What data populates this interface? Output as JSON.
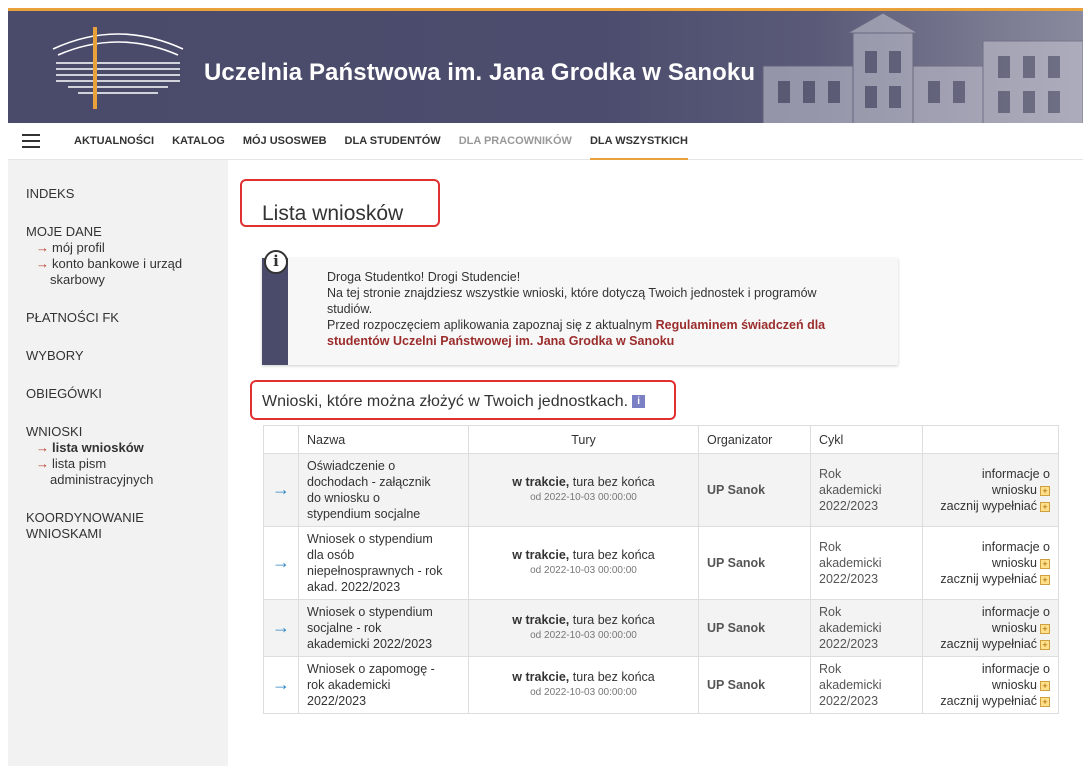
{
  "header": {
    "title": "Uczelnia Państwowa im. Jana Grodka w Sanoku"
  },
  "nav": {
    "items": [
      {
        "label": "AKTUALNOŚCI"
      },
      {
        "label": "KATALOG"
      },
      {
        "label": "MÓJ USOSWEB"
      },
      {
        "label": "DLA STUDENTÓW"
      },
      {
        "label": "DLA PRACOWNIKÓW"
      },
      {
        "label": "DLA WSZYSTKICH"
      }
    ]
  },
  "sidebar": {
    "indeks": "INDEKS",
    "moje_dane": "MOJE DANE",
    "moj_profil": "mój profil",
    "konto_1": "konto bankowe i urząd",
    "konto_2": "skarbowy",
    "platnosci": "PŁATNOŚCI FK",
    "wybory": "WYBORY",
    "obiegowki": "OBIEGÓWKI",
    "wnioski": "WNIOSKI",
    "lista_wnioskow": "lista wniosków",
    "lista_pism_1": "lista pism",
    "lista_pism_2": "administracyjnych",
    "koord_1": "KOORDYNOWANIE",
    "koord_2": "WNIOSKAMI"
  },
  "main": {
    "title": "Lista wniosków",
    "info": {
      "line1": "Droga Studentko! Drogi Studencie!",
      "line2": "Na tej stronie znajdziesz wszystkie wnioski, które dotyczą Twoich jednostek i programów",
      "line3": "studiów.",
      "line4": "Przed rozpoczęciem aplikowania zapoznaj się z aktualnym ",
      "link1": "Regulaminem świadczeń dla",
      "link2": "studentów Uczelni Państwowej im. Jana Grodka w Sanoku"
    },
    "subtitle": "Wnioski, które można złożyć w Twoich jednostkach.",
    "table": {
      "headers": {
        "nazwa": "Nazwa",
        "tury": "Tury",
        "organizator": "Organizator",
        "cykl": "Cykl"
      },
      "rows": [
        {
          "name_lines": [
            "Oświadczenie o",
            "dochodach - załącznik",
            "do wniosku o",
            "stypendium socjalne"
          ],
          "status": "w trakcie,",
          "status_rest": " tura bez końca",
          "date": "od 2022-10-03 00:00:00",
          "org": "UP Sanok",
          "cykl": [
            "Rok",
            "akademicki",
            "2022/2023"
          ],
          "act_info_1": "informacje o",
          "act_info_2": "wniosku",
          "act_fill": "zacznij wypełniać"
        },
        {
          "name_lines": [
            "Wniosek o stypendium",
            "dla osób",
            "niepełnosprawnych - rok",
            "akad. 2022/2023"
          ],
          "status": "w trakcie,",
          "status_rest": " tura bez końca",
          "date": "od 2022-10-03 00:00:00",
          "org": "UP Sanok",
          "cykl": [
            "Rok",
            "akademicki",
            "2022/2023"
          ],
          "act_info_1": "informacje o",
          "act_info_2": "wniosku",
          "act_fill": "zacznij wypełniać"
        },
        {
          "name_lines": [
            "Wniosek o stypendium",
            "socjalne - rok",
            "akademicki 2022/2023"
          ],
          "status": "w trakcie,",
          "status_rest": " tura bez końca",
          "date": "od 2022-10-03 00:00:00",
          "org": "UP Sanok",
          "cykl": [
            "Rok",
            "akademicki",
            "2022/2023"
          ],
          "act_info_1": "informacje o",
          "act_info_2": "wniosku",
          "act_fill": "zacznij wypełniać"
        },
        {
          "name_lines": [
            "Wniosek o zapomogę -",
            "rok akademicki",
            "2022/2023"
          ],
          "status": "w trakcie,",
          "status_rest": " tura bez końca",
          "date": "od 2022-10-03 00:00:00",
          "org": "UP Sanok",
          "cykl": [
            "Rok",
            "akademicki",
            "2022/2023"
          ],
          "act_info_1": "informacje o",
          "act_info_2": "wniosku",
          "act_fill": "zacznij wypełniać"
        }
      ]
    }
  }
}
